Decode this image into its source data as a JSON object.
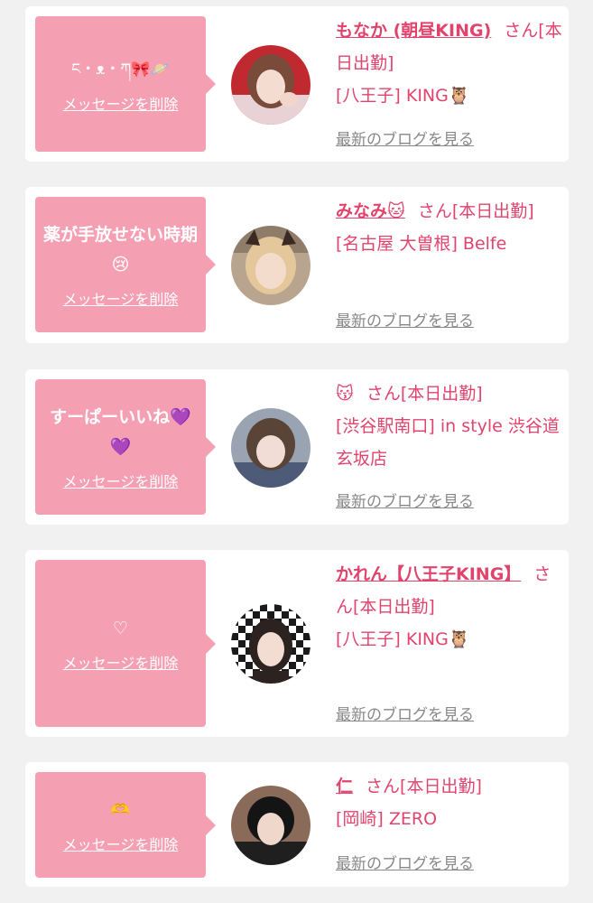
{
  "colors": {
    "page_bg": "#f1f1f1",
    "card_bg": "#ffffff",
    "bubble": "#f59fb3",
    "accent": "#e0446d",
    "muted": "#888888"
  },
  "cards": [
    {
      "message": "ང・ᴥ・ཀ🎀🪐",
      "delete_label": "メッセージを削除",
      "name": "もなか (朝昼KING)",
      "honorific": "さん",
      "status": "[本日出勤]",
      "shop": "[八王子] KING🦉",
      "blog_label": "最新のブログを見る"
    },
    {
      "message": "薬が手放せない時期😢",
      "delete_label": "メッセージを削除",
      "name": "みなみ🐱",
      "honorific": "さん",
      "status": "[本日出勤]",
      "shop": "[名古屋 大曽根] Belfe",
      "blog_label": "最新のブログを見る"
    },
    {
      "message": "すーぱーいいね💜💜",
      "delete_label": "メッセージを削除",
      "name": "😽",
      "honorific": "さん",
      "status": "[本日出勤]",
      "shop": "[渋谷駅南口] in style 渋谷道玄坂店",
      "blog_label": "最新のブログを見る"
    },
    {
      "message": "♡",
      "delete_label": "メッセージを削除",
      "name": "かれん【八王子KING】",
      "honorific": "さん",
      "status": "[本日出勤]",
      "shop": "[八王子] KING🦉",
      "blog_label": "最新のブログを見る"
    },
    {
      "message": "🫶",
      "delete_label": "メッセージを削除",
      "name": "仁",
      "honorific": "さん",
      "status": "[本日出勤]",
      "shop": "[岡崎] ZERO",
      "blog_label": "最新のブログを見る"
    }
  ]
}
